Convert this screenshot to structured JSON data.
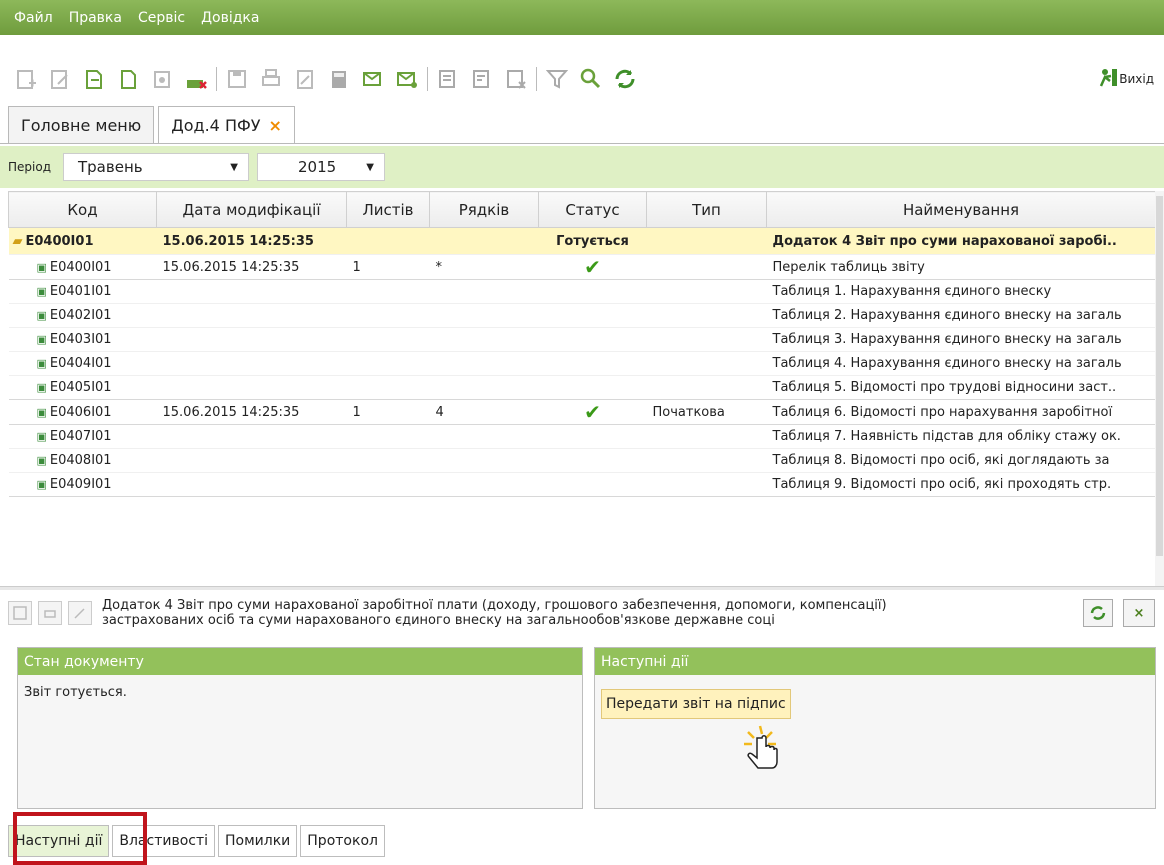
{
  "menu": [
    "Файл",
    "Правка",
    "Сервіс",
    "Довідка"
  ],
  "toolbar": {
    "exit_label": "Вихід"
  },
  "tabs": [
    {
      "label": "Головне меню",
      "active": false
    },
    {
      "label": "Дод.4 ПФУ",
      "active": true,
      "close": "×"
    }
  ],
  "period": {
    "label": "Період",
    "month": "Травень",
    "year": "2015"
  },
  "grid": {
    "headers": [
      "Код",
      "Дата модифікації",
      "Листів",
      "Рядків",
      "Статус",
      "Тип",
      "Найменування"
    ],
    "group": {
      "code": "E0400I01",
      "date": "15.06.2015 14:25:35",
      "status": "Готується",
      "name": "Додаток 4 Звіт про суми нарахованої заробі.."
    },
    "rows": [
      {
        "code": "E0400I01",
        "date": "15.06.2015 14:25:35",
        "sheets": "1",
        "rows": "*",
        "status_check": true,
        "type": "",
        "name": "Перелік таблиць звіту"
      },
      {
        "code": "E0401I01",
        "date": "",
        "sheets": "",
        "rows": "",
        "status_check": false,
        "type": "",
        "name": "Таблиця 1. Нарахування єдиного внеску"
      },
      {
        "code": "E0402I01",
        "date": "",
        "sheets": "",
        "rows": "",
        "status_check": false,
        "type": "",
        "name": "Таблиця 2. Нарахування єдиного внеску на загаль"
      },
      {
        "code": "E0403I01",
        "date": "",
        "sheets": "",
        "rows": "",
        "status_check": false,
        "type": "",
        "name": "Таблиця 3. Нарахування єдиного внеску на загаль"
      },
      {
        "code": "E0404I01",
        "date": "",
        "sheets": "",
        "rows": "",
        "status_check": false,
        "type": "",
        "name": "Таблиця 4. Нарахування єдиного внеску на загаль"
      },
      {
        "code": "E0405I01",
        "date": "",
        "sheets": "",
        "rows": "",
        "status_check": false,
        "type": "",
        "name": "Таблиця 5. Відомості про трудові відносини заст.."
      },
      {
        "code": "E0406I01",
        "date": "15.06.2015 14:25:35",
        "sheets": "1",
        "rows": "4",
        "status_check": true,
        "type": "Початкова",
        "name": "Таблиця 6. Відомості про нарахування заробітної"
      },
      {
        "code": "E0407I01",
        "date": "",
        "sheets": "",
        "rows": "",
        "status_check": false,
        "type": "",
        "name": "Таблиця 7. Наявність підстав для обліку стажу ок."
      },
      {
        "code": "E0408I01",
        "date": "",
        "sheets": "",
        "rows": "",
        "status_check": false,
        "type": "",
        "name": "Таблиця 8. Відомості про осіб, які доглядають за"
      },
      {
        "code": "E0409I01",
        "date": "",
        "sheets": "",
        "rows": "",
        "status_check": false,
        "type": "",
        "name": "Таблиця 9. Відомості про осіб, які проходять стр."
      }
    ]
  },
  "document": {
    "title_line1": "Додаток 4 Звіт про суми нарахованої заробітної плати (доходу, грошового забезпечення, допомоги, компенсації)",
    "title_line2": "застрахованих осіб та суми нарахованого єдиного внеску на загальнообов'язкове державне соці",
    "close": "×"
  },
  "state_panel": {
    "title": "Стан документу",
    "text": "Звіт готується."
  },
  "next_panel": {
    "title": "Наступні дії",
    "action": "Передати звіт на підпис"
  },
  "bottom_tabs": [
    "Наступні дії",
    "Властивості",
    "Помилки",
    "Протокол"
  ],
  "colors": {
    "menubar": "#7aa846",
    "panel_header": "#93c15b",
    "group_row": "#fff7c2",
    "period_bar": "#dff0c5",
    "highlight": "#c0141c",
    "check": "#3b9a18"
  }
}
